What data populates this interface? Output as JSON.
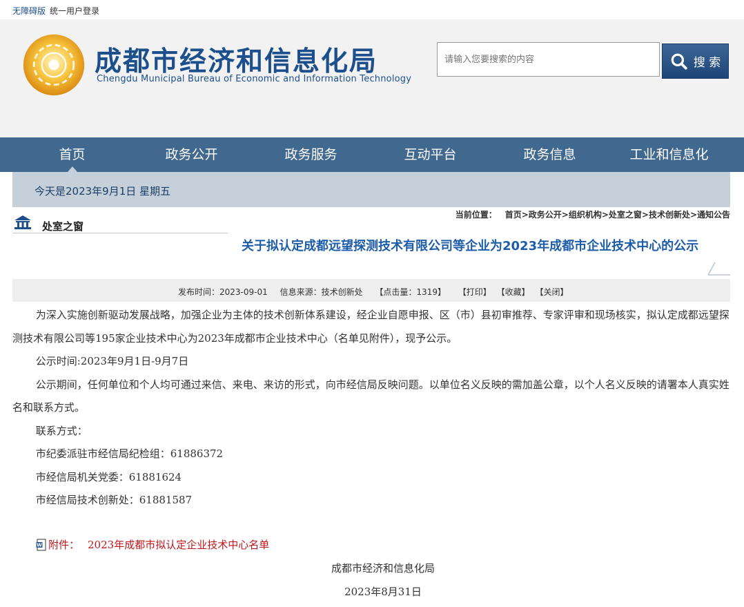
{
  "topbar": {
    "accessibility": "无障碍版",
    "login": "统一用户登录"
  },
  "header": {
    "org_cn": "成都市经济和信息化局",
    "org_en": "Chengdu Municipal Bureau of Economic and Information Technology"
  },
  "search": {
    "placeholder": "请输入您要搜索的内容",
    "button_label": "搜 索"
  },
  "nav": {
    "items": [
      {
        "label": "首页",
        "active": true
      },
      {
        "label": "政务公开"
      },
      {
        "label": "政务服务"
      },
      {
        "label": "互动平台"
      },
      {
        "label": "政务信息"
      },
      {
        "label": "工业和信息化"
      }
    ]
  },
  "date_bar": {
    "text": "今天是2023年9月1日 星期五"
  },
  "sidebar": {
    "title": "处室之窗"
  },
  "breadcrumb": {
    "label": "当前位置：",
    "path": "首页>政务公开>组织机构>处室之窗>技术创新处>通知公告"
  },
  "article": {
    "title": "关于拟认定成都远望探测技术有限公司等企业为2023年成都市企业技术中心的公示",
    "meta": {
      "publish_time": "发布时间：2023-09-01",
      "source": "信息来源：技术创新处",
      "hits": "【点击量：1319】",
      "print": "【打印】",
      "favorite": "【收藏】",
      "close": "【关闭】"
    },
    "paragraphs": [
      "为深入实施创新驱动发展战略，加强企业为主体的技术创新体系建设，经企业自愿申报、区（市）县初审推荐、专家评审和现场核实，拟认定成都远望探测技术有限公司等195家企业技术中心为2023年成都市企业技术中心（名单见附件），现予公示。",
      "公示时间:2023年9月1日-9月7日",
      "公示期间，任何单位和个人均可通过来信、来电、来访的形式，向市经信局反映问题。以单位名义反映的需加盖公章，以个人名义反映的请署本人真实姓名和联系方式。",
      "联系方式：",
      "市纪委派驻市经信局纪检组：61886372",
      "市经信局机关党委：61881624",
      "市经信局技术创新处：61881587"
    ],
    "attachment_label": "附件：",
    "attachment_name": "2023年成都市拟认定企业技术中心名单",
    "signature_org": "成都市经济和信息化局",
    "signature_date": "2023年8月31日"
  },
  "colors": {
    "brand_blue": "#1c4f8c",
    "nav_bg": "#41698f",
    "title_blue": "#1c5ca8",
    "attachment_red": "#c0161b"
  }
}
